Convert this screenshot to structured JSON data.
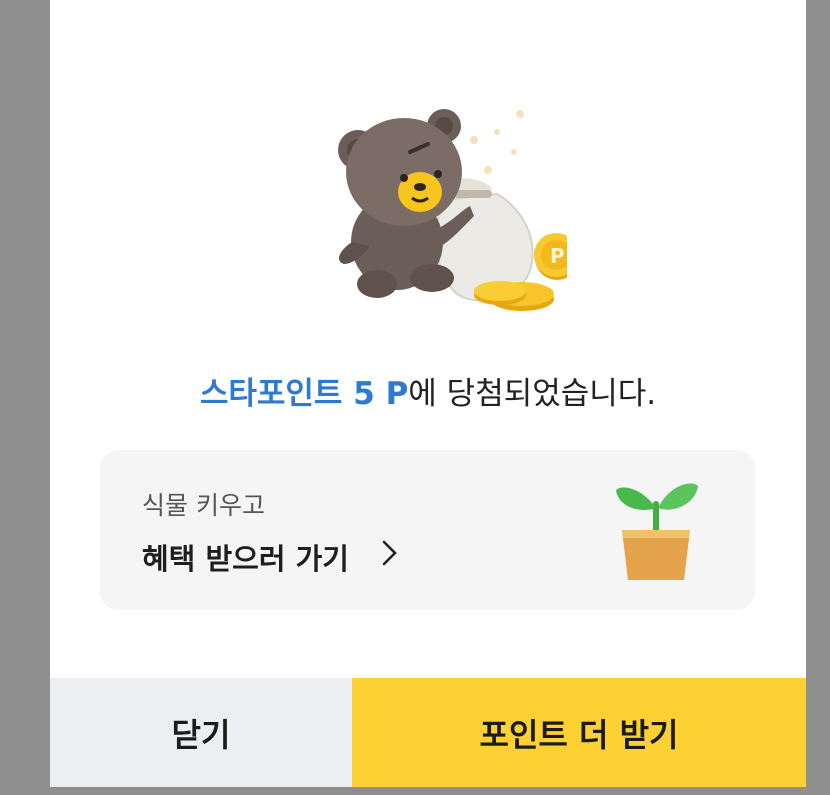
{
  "result": {
    "prefix_highlight": "스타포인트 5 P",
    "suffix": "에 당첨되었습니다."
  },
  "promo": {
    "subtitle": "식물 키우고",
    "title": "혜택 받으러 가기",
    "chevron": ">"
  },
  "buttons": {
    "close": "닫기",
    "more_points": "포인트 더 받기"
  },
  "icons": {
    "illustration": "bear-with-money-bag-and-coins",
    "plant": "potted-sprout-icon",
    "chevron": "chevron-right-icon"
  },
  "colors": {
    "accent": "#2f7ad1",
    "primary_button": "#fdd033",
    "secondary_button": "#eceef1",
    "card_bg": "#f5f5f6"
  }
}
